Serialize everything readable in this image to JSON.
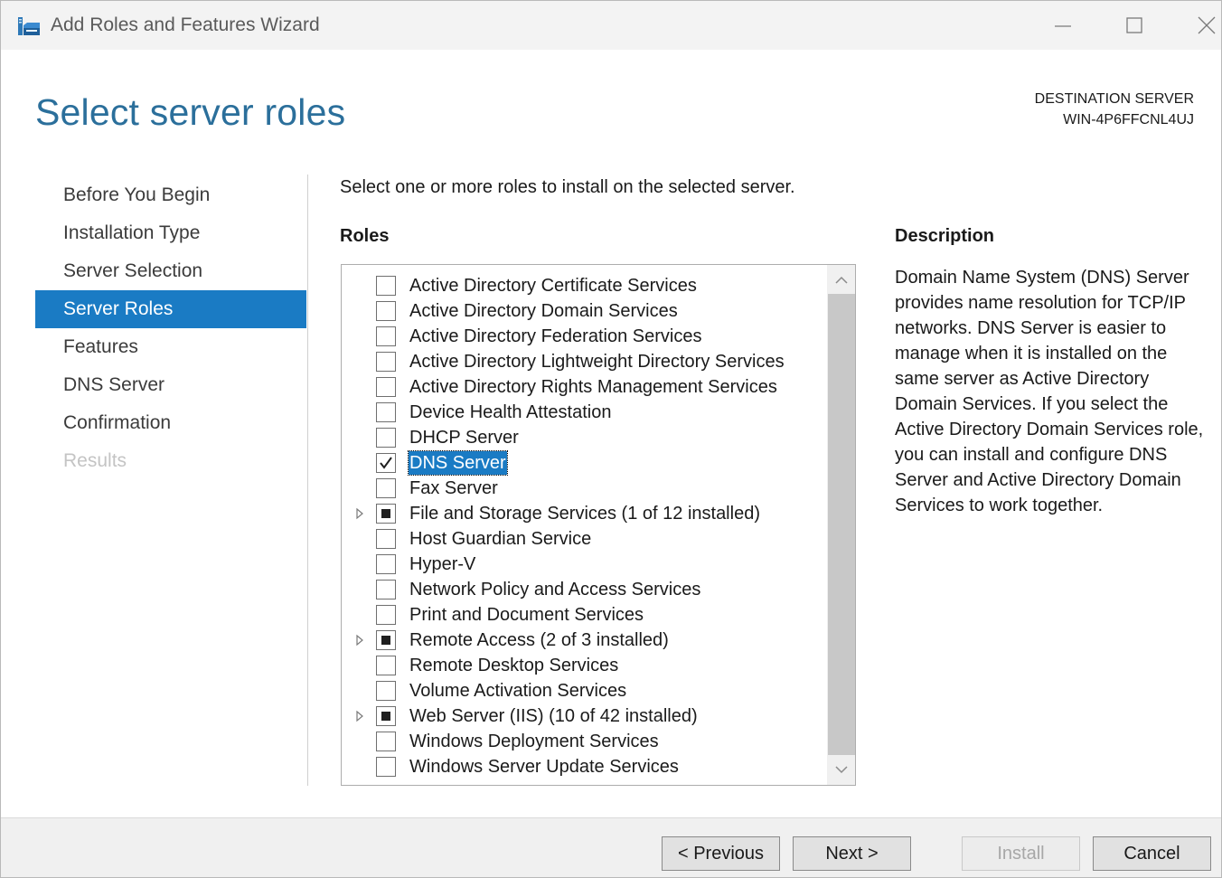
{
  "window": {
    "title": "Add Roles and Features Wizard"
  },
  "header": {
    "page_title": "Select server roles",
    "destination_label": "DESTINATION SERVER",
    "destination_server": "WIN-4P6FFCNL4UJ"
  },
  "nav": {
    "items": [
      {
        "label": "Before You Begin",
        "state": "normal"
      },
      {
        "label": "Installation Type",
        "state": "normal"
      },
      {
        "label": "Server Selection",
        "state": "normal"
      },
      {
        "label": "Server Roles",
        "state": "active"
      },
      {
        "label": "Features",
        "state": "normal"
      },
      {
        "label": "DNS Server",
        "state": "normal"
      },
      {
        "label": "Confirmation",
        "state": "normal"
      },
      {
        "label": "Results",
        "state": "disabled"
      }
    ]
  },
  "main": {
    "instruction": "Select one or more roles to install on the selected server.",
    "roles_heading": "Roles",
    "roles": [
      {
        "label": "Active Directory Certificate Services",
        "state": "unchecked",
        "expandable": false
      },
      {
        "label": "Active Directory Domain Services",
        "state": "unchecked",
        "expandable": false
      },
      {
        "label": "Active Directory Federation Services",
        "state": "unchecked",
        "expandable": false
      },
      {
        "label": "Active Directory Lightweight Directory Services",
        "state": "unchecked",
        "expandable": false
      },
      {
        "label": "Active Directory Rights Management Services",
        "state": "unchecked",
        "expandable": false
      },
      {
        "label": "Device Health Attestation",
        "state": "unchecked",
        "expandable": false
      },
      {
        "label": "DHCP Server",
        "state": "unchecked",
        "expandable": false
      },
      {
        "label": "DNS Server",
        "state": "checked",
        "expandable": false,
        "selected": true
      },
      {
        "label": "Fax Server",
        "state": "unchecked",
        "expandable": false
      },
      {
        "label": "File and Storage Services (1 of 12 installed)",
        "state": "partial",
        "expandable": true
      },
      {
        "label": "Host Guardian Service",
        "state": "unchecked",
        "expandable": false
      },
      {
        "label": "Hyper-V",
        "state": "unchecked",
        "expandable": false
      },
      {
        "label": "Network Policy and Access Services",
        "state": "unchecked",
        "expandable": false
      },
      {
        "label": "Print and Document Services",
        "state": "unchecked",
        "expandable": false
      },
      {
        "label": "Remote Access (2 of 3 installed)",
        "state": "partial",
        "expandable": true
      },
      {
        "label": "Remote Desktop Services",
        "state": "unchecked",
        "expandable": false
      },
      {
        "label": "Volume Activation Services",
        "state": "unchecked",
        "expandable": false
      },
      {
        "label": "Web Server (IIS) (10 of 42 installed)",
        "state": "partial",
        "expandable": true
      },
      {
        "label": "Windows Deployment Services",
        "state": "unchecked",
        "expandable": false
      },
      {
        "label": "Windows Server Update Services",
        "state": "unchecked",
        "expandable": false
      }
    ],
    "description_heading": "Description",
    "description_text": "Domain Name System (DNS) Server provides name resolution for TCP/IP networks. DNS Server is easier to manage when it is installed on the same server as Active Directory Domain Services. If you select the Active Directory Domain Services role, you can install and configure DNS Server and Active Directory Domain Services to work together."
  },
  "footer": {
    "previous_label": "< Previous",
    "next_label": "Next >",
    "install_label": "Install",
    "cancel_label": "Cancel"
  },
  "colors": {
    "accent": "#1a7bc4",
    "title_blue": "#2b6f9b",
    "disabled_text": "#c4c4c4"
  },
  "icons": {
    "app": "server-manager-icon",
    "minimize": "minimize-icon",
    "maximize": "maximize-icon",
    "close": "close-icon",
    "expander": "triangle-right-icon",
    "check": "checkmark-icon"
  }
}
